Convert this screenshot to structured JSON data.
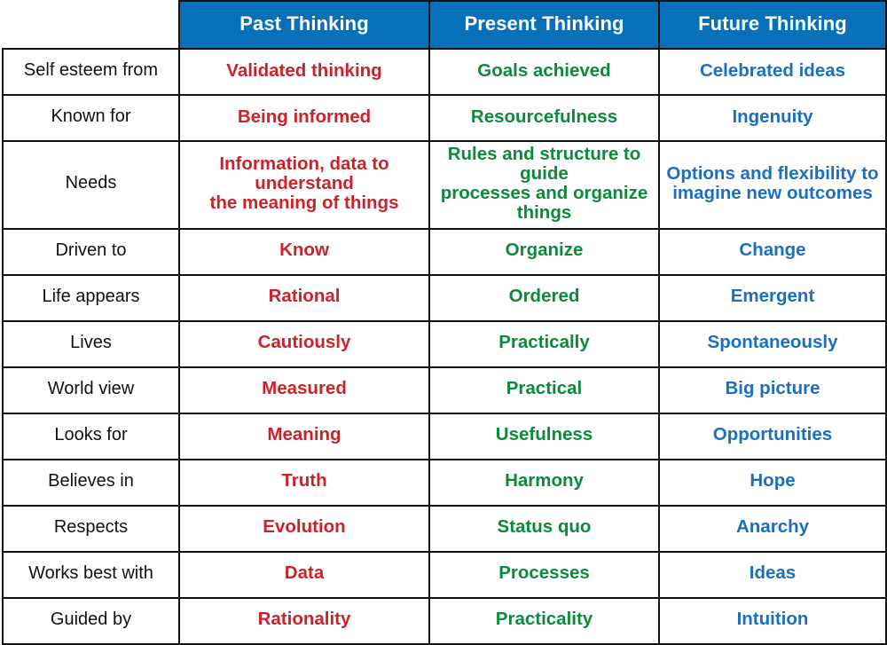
{
  "table": {
    "corner_label": "",
    "columns": [
      {
        "key": "label",
        "header": ""
      },
      {
        "key": "past",
        "header": "Past Thinking"
      },
      {
        "key": "present",
        "header": "Present Thinking"
      },
      {
        "key": "future",
        "header": "Future Thinking"
      }
    ],
    "colors": {
      "header_background": "#0670B8",
      "header_text": "#FFFFFF",
      "border": "#111111",
      "past_text": "#CC2229",
      "present_text": "#0C8A3C",
      "future_text": "#1B6FC1",
      "label_text": "#111111",
      "cell_background": "#FFFFFF"
    },
    "rows": [
      {
        "label": "Self esteem from",
        "past": "Validated thinking",
        "present": "Goals achieved",
        "future": "Celebrated ideas"
      },
      {
        "label": "Known for",
        "past": "Being informed",
        "present": "Resourcefulness",
        "future": "Ingenuity"
      },
      {
        "label": "Needs",
        "past": "Information, data to understand",
        "past_line2": "the meaning of things",
        "present": "Rules and structure to guide",
        "present_line2": "processes and organize things",
        "future": "Options and flexibility to",
        "future_line2": "imagine new outcomes"
      },
      {
        "label": "Driven to",
        "past": "Know",
        "present": "Organize",
        "future": "Change"
      },
      {
        "label": "Life appears",
        "past": "Rational",
        "present": "Ordered",
        "future": "Emergent"
      },
      {
        "label": "Lives",
        "past": "Cautiously",
        "present": "Practically",
        "future": "Spontaneously"
      },
      {
        "label": "World view",
        "past": "Measured",
        "present": "Practical",
        "future": "Big picture"
      },
      {
        "label": "Looks for",
        "past": "Meaning",
        "present": "Usefulness",
        "future": "Opportunities"
      },
      {
        "label": "Believes in",
        "past": "Truth",
        "present": "Harmony",
        "future": "Hope"
      },
      {
        "label": "Respects",
        "past": "Evolution",
        "present": "Status quo",
        "future": "Anarchy"
      },
      {
        "label": "Works best with",
        "past": "Data",
        "present": "Processes",
        "future": "Ideas"
      },
      {
        "label": "Guided by",
        "past": "Rationality",
        "present": "Practicality",
        "future": "Intuition"
      }
    ]
  }
}
